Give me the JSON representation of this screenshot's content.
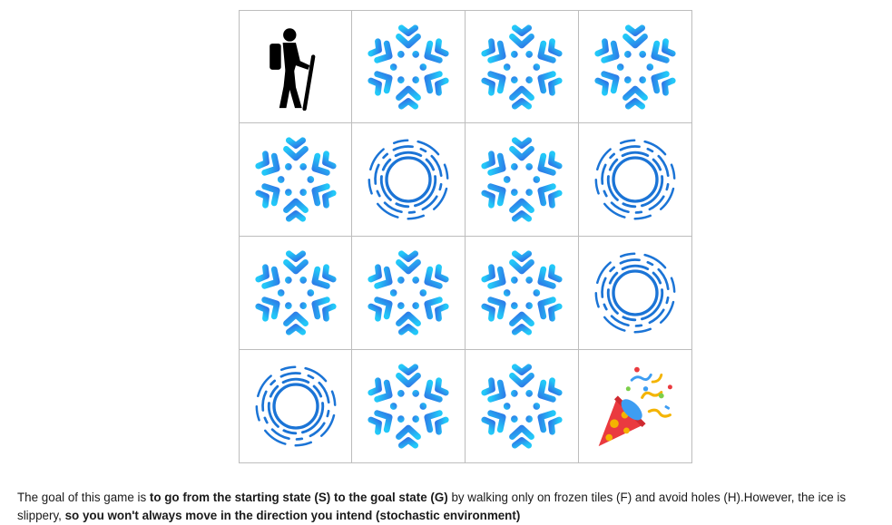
{
  "grid": {
    "rows": [
      [
        "S",
        "F",
        "F",
        "F"
      ],
      [
        "F",
        "H",
        "F",
        "H"
      ],
      [
        "F",
        "F",
        "F",
        "H"
      ],
      [
        "H",
        "F",
        "F",
        "G"
      ]
    ],
    "tiles": {
      "S": {
        "name": "hiker-icon",
        "color": "#000000"
      },
      "F": {
        "name": "snowflake-icon",
        "color": "#2ea7f0"
      },
      "H": {
        "name": "hole-icon",
        "color": "#1b74d6"
      },
      "G": {
        "name": "party-popper-icon",
        "color": "#e63946"
      }
    }
  },
  "caption": {
    "part1": "The goal of this game is ",
    "bold1": "to go from the starting state (S) to the goal state (G)",
    "part2": " by walking only on frozen tiles (F) and avoid holes (H).However, the ice is slippery, ",
    "bold2": "so you won't always move in the direction you intend (stochastic environment)"
  }
}
